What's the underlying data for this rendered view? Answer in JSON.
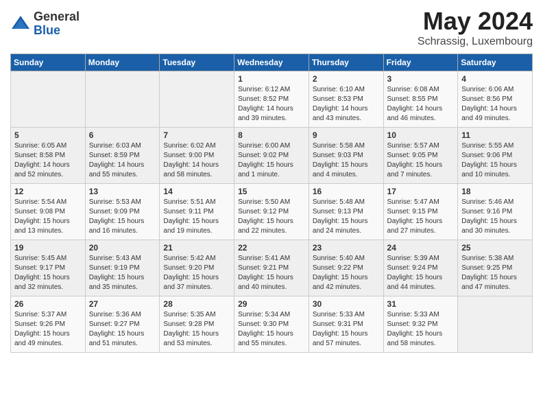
{
  "logo": {
    "general": "General",
    "blue": "Blue"
  },
  "title": "May 2024",
  "subtitle": "Schrassig, Luxembourg",
  "days_header": [
    "Sunday",
    "Monday",
    "Tuesday",
    "Wednesday",
    "Thursday",
    "Friday",
    "Saturday"
  ],
  "weeks": [
    [
      {
        "day": "",
        "info": ""
      },
      {
        "day": "",
        "info": ""
      },
      {
        "day": "",
        "info": ""
      },
      {
        "day": "1",
        "info": "Sunrise: 6:12 AM\nSunset: 8:52 PM\nDaylight: 14 hours\nand 39 minutes."
      },
      {
        "day": "2",
        "info": "Sunrise: 6:10 AM\nSunset: 8:53 PM\nDaylight: 14 hours\nand 43 minutes."
      },
      {
        "day": "3",
        "info": "Sunrise: 6:08 AM\nSunset: 8:55 PM\nDaylight: 14 hours\nand 46 minutes."
      },
      {
        "day": "4",
        "info": "Sunrise: 6:06 AM\nSunset: 8:56 PM\nDaylight: 14 hours\nand 49 minutes."
      }
    ],
    [
      {
        "day": "5",
        "info": "Sunrise: 6:05 AM\nSunset: 8:58 PM\nDaylight: 14 hours\nand 52 minutes."
      },
      {
        "day": "6",
        "info": "Sunrise: 6:03 AM\nSunset: 8:59 PM\nDaylight: 14 hours\nand 55 minutes."
      },
      {
        "day": "7",
        "info": "Sunrise: 6:02 AM\nSunset: 9:00 PM\nDaylight: 14 hours\nand 58 minutes."
      },
      {
        "day": "8",
        "info": "Sunrise: 6:00 AM\nSunset: 9:02 PM\nDaylight: 15 hours\nand 1 minute."
      },
      {
        "day": "9",
        "info": "Sunrise: 5:58 AM\nSunset: 9:03 PM\nDaylight: 15 hours\nand 4 minutes."
      },
      {
        "day": "10",
        "info": "Sunrise: 5:57 AM\nSunset: 9:05 PM\nDaylight: 15 hours\nand 7 minutes."
      },
      {
        "day": "11",
        "info": "Sunrise: 5:55 AM\nSunset: 9:06 PM\nDaylight: 15 hours\nand 10 minutes."
      }
    ],
    [
      {
        "day": "12",
        "info": "Sunrise: 5:54 AM\nSunset: 9:08 PM\nDaylight: 15 hours\nand 13 minutes."
      },
      {
        "day": "13",
        "info": "Sunrise: 5:53 AM\nSunset: 9:09 PM\nDaylight: 15 hours\nand 16 minutes."
      },
      {
        "day": "14",
        "info": "Sunrise: 5:51 AM\nSunset: 9:11 PM\nDaylight: 15 hours\nand 19 minutes."
      },
      {
        "day": "15",
        "info": "Sunrise: 5:50 AM\nSunset: 9:12 PM\nDaylight: 15 hours\nand 22 minutes."
      },
      {
        "day": "16",
        "info": "Sunrise: 5:48 AM\nSunset: 9:13 PM\nDaylight: 15 hours\nand 24 minutes."
      },
      {
        "day": "17",
        "info": "Sunrise: 5:47 AM\nSunset: 9:15 PM\nDaylight: 15 hours\nand 27 minutes."
      },
      {
        "day": "18",
        "info": "Sunrise: 5:46 AM\nSunset: 9:16 PM\nDaylight: 15 hours\nand 30 minutes."
      }
    ],
    [
      {
        "day": "19",
        "info": "Sunrise: 5:45 AM\nSunset: 9:17 PM\nDaylight: 15 hours\nand 32 minutes."
      },
      {
        "day": "20",
        "info": "Sunrise: 5:43 AM\nSunset: 9:19 PM\nDaylight: 15 hours\nand 35 minutes."
      },
      {
        "day": "21",
        "info": "Sunrise: 5:42 AM\nSunset: 9:20 PM\nDaylight: 15 hours\nand 37 minutes."
      },
      {
        "day": "22",
        "info": "Sunrise: 5:41 AM\nSunset: 9:21 PM\nDaylight: 15 hours\nand 40 minutes."
      },
      {
        "day": "23",
        "info": "Sunrise: 5:40 AM\nSunset: 9:22 PM\nDaylight: 15 hours\nand 42 minutes."
      },
      {
        "day": "24",
        "info": "Sunrise: 5:39 AM\nSunset: 9:24 PM\nDaylight: 15 hours\nand 44 minutes."
      },
      {
        "day": "25",
        "info": "Sunrise: 5:38 AM\nSunset: 9:25 PM\nDaylight: 15 hours\nand 47 minutes."
      }
    ],
    [
      {
        "day": "26",
        "info": "Sunrise: 5:37 AM\nSunset: 9:26 PM\nDaylight: 15 hours\nand 49 minutes."
      },
      {
        "day": "27",
        "info": "Sunrise: 5:36 AM\nSunset: 9:27 PM\nDaylight: 15 hours\nand 51 minutes."
      },
      {
        "day": "28",
        "info": "Sunrise: 5:35 AM\nSunset: 9:28 PM\nDaylight: 15 hours\nand 53 minutes."
      },
      {
        "day": "29",
        "info": "Sunrise: 5:34 AM\nSunset: 9:30 PM\nDaylight: 15 hours\nand 55 minutes."
      },
      {
        "day": "30",
        "info": "Sunrise: 5:33 AM\nSunset: 9:31 PM\nDaylight: 15 hours\nand 57 minutes."
      },
      {
        "day": "31",
        "info": "Sunrise: 5:33 AM\nSunset: 9:32 PM\nDaylight: 15 hours\nand 58 minutes."
      },
      {
        "day": "",
        "info": ""
      }
    ]
  ]
}
